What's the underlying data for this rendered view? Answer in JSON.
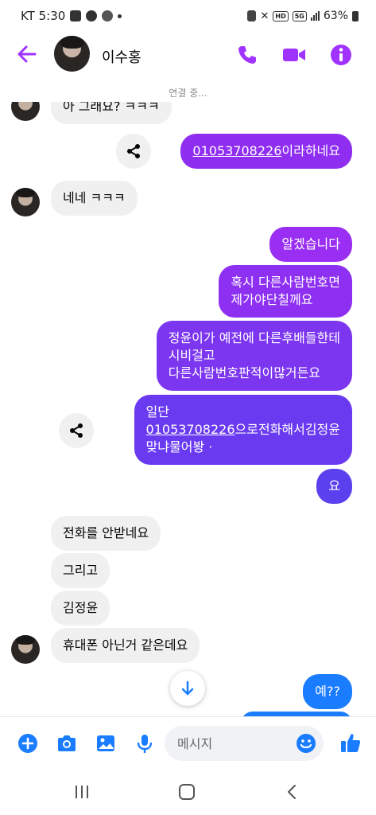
{
  "status_bar": {
    "carrier_time": "KT 5:30",
    "network_tag": "5G",
    "hd_tag": "HD",
    "battery": "63%"
  },
  "header": {
    "contact_name": "이수홍",
    "status": "연결 중..."
  },
  "messages": {
    "partial_incoming": "아 그래요? ㅋㅋㅋ",
    "out_phone_link": "01053708226",
    "out_phone_rest": "이라하네요",
    "in_nene": "네네 ㅋㅋㅋ",
    "out_1": "알겠습니다",
    "out_2": "혹시 다른사람번호면\n제가야단칠께요",
    "out_3": "정윤이가 예전에 다른후배들한테\n시비걸고\n다른사람번호판적이많거든요",
    "out_4_line1": "일단",
    "out_4_link": "01053708226",
    "out_4_rest": "으로전화해서김정윤",
    "out_4_line3": "맞냐물어봥 ·",
    "out_5": "요",
    "in_1": "전화를 안받네요",
    "in_2": "그리고",
    "in_3": "김정윤",
    "in_4": "휴대폰 아닌거 같은데요",
    "out_6": "예??"
  },
  "composer": {
    "placeholder": "메시지"
  },
  "colors": {
    "accent": "#a033ff",
    "bubble_purple": "#8f2ef0",
    "bubble_blue": "#1a7cff",
    "incoming_bubble": "#f0f0f0"
  },
  "icons": [
    "back-arrow-icon",
    "phone-icon",
    "video-icon",
    "info-icon",
    "share-icon",
    "arrow-down-icon",
    "plus-icon",
    "camera-icon",
    "gallery-icon",
    "mic-icon",
    "emoji-icon",
    "like-icon"
  ]
}
